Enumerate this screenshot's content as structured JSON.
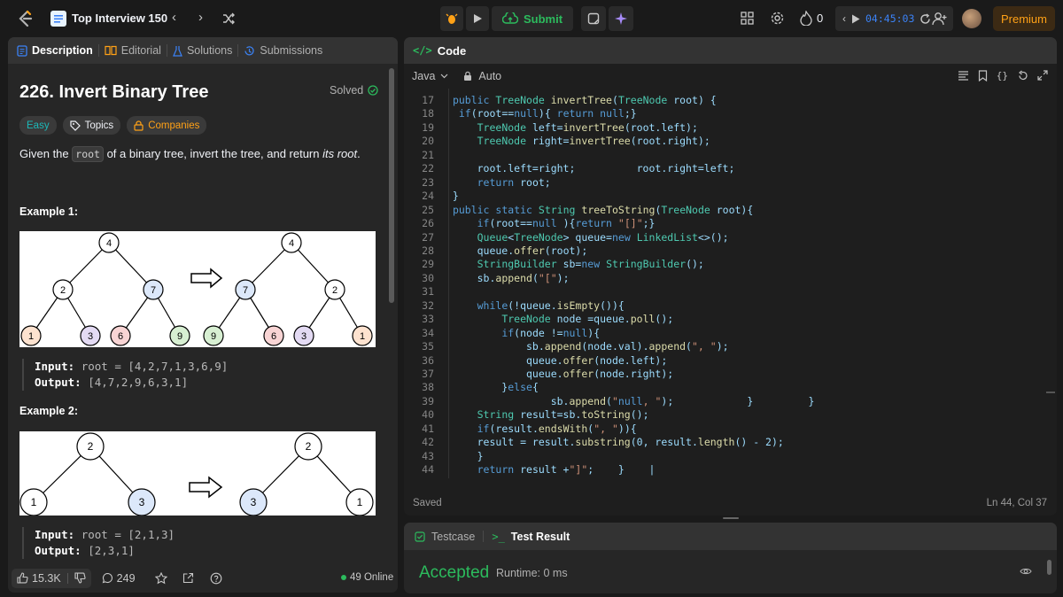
{
  "topbar": {
    "title": "Top Interview 150",
    "submit_label": "Submit",
    "streak_count": "0",
    "timer": "04:45:03",
    "premium_label": "Premium"
  },
  "left_panel": {
    "tabs": [
      {
        "label": "Description",
        "icon": "description-icon",
        "active": true
      },
      {
        "label": "Editorial",
        "icon": "book-icon"
      },
      {
        "label": "Solutions",
        "icon": "flask-icon"
      },
      {
        "label": "Submissions",
        "icon": "history-icon"
      }
    ],
    "question_title": "226. Invert Binary Tree",
    "solved_label": "Solved",
    "chips": {
      "difficulty": "Easy",
      "topics": "Topics",
      "companies": "Companies"
    },
    "description_before": "Given the ",
    "description_code": "root",
    "description_after": " of a binary tree, invert the tree, and return ",
    "description_em": "its root",
    "description_end": ".",
    "example1": {
      "heading": "Example 1:",
      "input_label": "Input:",
      "input_value": "root = [4,2,7,1,3,6,9]",
      "output_label": "Output:",
      "output_value": "[4,7,2,9,6,3,1]",
      "tree_before": [
        "4",
        "2",
        "7",
        "1",
        "3",
        "6",
        "9"
      ],
      "tree_after": [
        "4",
        "7",
        "2",
        "9",
        "6",
        "3",
        "1"
      ]
    },
    "example2": {
      "heading": "Example 2:",
      "input_label": "Input:",
      "input_value": "root = [2,1,3]",
      "output_label": "Output:",
      "output_value": "[2,3,1]",
      "tree_before": [
        "2",
        "1",
        "3"
      ],
      "tree_after": [
        "2",
        "3",
        "1"
      ]
    },
    "footer": {
      "likes": "15.3K",
      "comments": "249",
      "online": "49 Online"
    }
  },
  "code_panel": {
    "title": "Code",
    "language": "Java",
    "mode": "Auto",
    "status": "Saved",
    "cursor": "Ln 44, Col 37",
    "lines": [
      {
        "n": "17",
        "i": 0,
        "t": " public TreeNode invertTree(TreeNode root) {"
      },
      {
        "n": "18",
        "i": 0,
        "t": "  if(root==null){ return null;}"
      },
      {
        "n": "19",
        "i": 0,
        "t": "     TreeNode left=invertTree(root.left);"
      },
      {
        "n": "20",
        "i": 0,
        "t": "     TreeNode right=invertTree(root.right);"
      },
      {
        "n": "21",
        "i": 0,
        "t": ""
      },
      {
        "n": "22",
        "i": 0,
        "t": "     root.left=right;          root.right=left;"
      },
      {
        "n": "23",
        "i": 0,
        "t": "     return root;"
      },
      {
        "n": "24",
        "i": 0,
        "t": " }"
      },
      {
        "n": "25",
        "i": 0,
        "t": " public static String treeToString(TreeNode root){"
      },
      {
        "n": "26",
        "i": 0,
        "t": "     if(root==null ){return \"[]\";}"
      },
      {
        "n": "27",
        "i": 0,
        "t": "     Queue<TreeNode> queue=new LinkedList<>();"
      },
      {
        "n": "28",
        "i": 0,
        "t": "     queue.offer(root);"
      },
      {
        "n": "29",
        "i": 0,
        "t": "     StringBuilder sb=new StringBuilder();"
      },
      {
        "n": "30",
        "i": 0,
        "t": "     sb.append(\"[\");"
      },
      {
        "n": "31",
        "i": 0,
        "t": ""
      },
      {
        "n": "32",
        "i": 0,
        "t": "     while(!queue.isEmpty()){"
      },
      {
        "n": "33",
        "i": 0,
        "t": "         TreeNode node =queue.poll();"
      },
      {
        "n": "34",
        "i": 0,
        "t": "         if(node !=null){"
      },
      {
        "n": "35",
        "i": 0,
        "t": "             sb.append(node.val).append(\", \");"
      },
      {
        "n": "36",
        "i": 0,
        "t": "             queue.offer(node.left);"
      },
      {
        "n": "37",
        "i": 0,
        "t": "             queue.offer(node.right);"
      },
      {
        "n": "38",
        "i": 0,
        "t": "         }else{"
      },
      {
        "n": "39",
        "i": 0,
        "t": "                 sb.append(\"null, \");            }         }"
      },
      {
        "n": "40",
        "i": 0,
        "t": "     String result=sb.toString();"
      },
      {
        "n": "41",
        "i": 0,
        "t": "     if(result.endsWith(\", \")){"
      },
      {
        "n": "42",
        "i": 0,
        "t": "     result = result.substring(0, result.length() - 2);"
      },
      {
        "n": "43",
        "i": 0,
        "t": "     }"
      },
      {
        "n": "44",
        "i": 0,
        "t": "     return result +\"]\";    }    |"
      }
    ]
  },
  "result_panel": {
    "testcase_label": "Testcase",
    "test_result_label": "Test Result",
    "status": "Accepted",
    "runtime": "Runtime: 0 ms"
  },
  "colors": {
    "accent_orange": "#ffa116",
    "accepted_green": "#2cbb5d",
    "easy_teal": "#1cb8b8",
    "timer_blue": "#3b82f6"
  }
}
